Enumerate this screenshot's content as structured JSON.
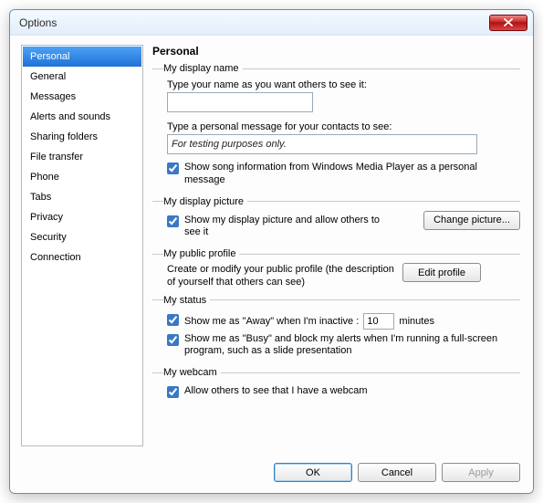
{
  "window": {
    "title": "Options"
  },
  "sidebar": {
    "items": [
      "Personal",
      "General",
      "Messages",
      "Alerts and sounds",
      "Sharing folders",
      "File transfer",
      "Phone",
      "Tabs",
      "Privacy",
      "Security",
      "Connection"
    ],
    "selected_index": 0
  },
  "page": {
    "title": "Personal",
    "groups": {
      "display_name": {
        "legend": "My display name",
        "name_label": "Type your name as you want others to see it:",
        "name_value": "",
        "msg_label": "Type a personal message for your contacts to see:",
        "msg_value": "For testing purposes only.",
        "song_checked": true,
        "song_label": "Show song information from Windows Media Player as a personal message"
      },
      "display_picture": {
        "legend": "My display picture",
        "show_checked": true,
        "show_label": "Show my display picture and allow others to see it",
        "change_btn": "Change picture..."
      },
      "public_profile": {
        "legend": "My public profile",
        "desc": "Create or modify your public profile (the description of yourself that others can see)",
        "edit_btn": "Edit profile"
      },
      "status": {
        "legend": "My status",
        "away_checked": true,
        "away_label_pre": "Show me as \"Away\" when I'm inactive :",
        "away_minutes": "10",
        "away_label_post": "minutes",
        "busy_checked": true,
        "busy_label": "Show me as \"Busy\" and block my alerts when I'm running a full-screen program, such as a slide presentation"
      },
      "webcam": {
        "legend": "My webcam",
        "allow_checked": true,
        "allow_label": "Allow others to see that I have a webcam"
      }
    }
  },
  "buttons": {
    "ok": "OK",
    "cancel": "Cancel",
    "apply": "Apply"
  }
}
